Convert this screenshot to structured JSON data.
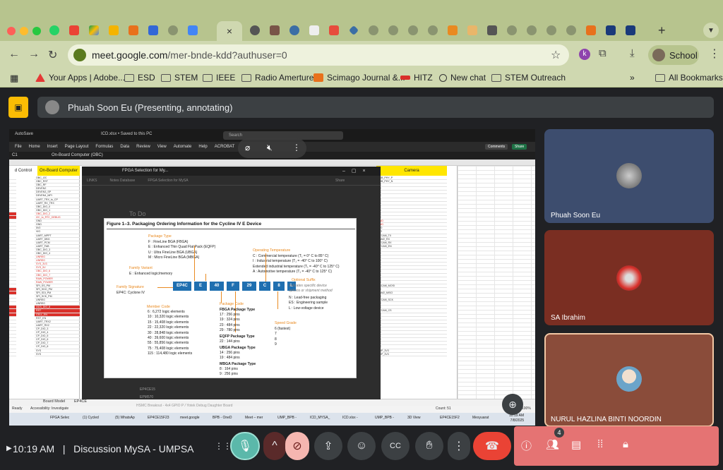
{
  "browser": {
    "url_host": "meet.google.com",
    "url_path": "/mer-bnde-kdd?authuser=0",
    "profile_label": "School",
    "extension_letter": "k",
    "new_tab_symbol": "+",
    "active_tab_close": "×",
    "accent": "#cfd8b0",
    "tabstrip_color": "#b7c48e"
  },
  "bookmarks": [
    {
      "label": "Your Apps | Adobe...",
      "icon": "adobe-icon"
    },
    {
      "label": "ESD",
      "icon": "folder-icon"
    },
    {
      "label": "STEM",
      "icon": "folder-icon"
    },
    {
      "label": "IEEE",
      "icon": "folder-icon"
    },
    {
      "label": "Radio Amerture",
      "icon": "folder-icon"
    },
    {
      "label": "Scimago Journal &...",
      "icon": "sjr-icon"
    },
    {
      "label": "HITZ",
      "icon": "hitz-icon"
    },
    {
      "label": "New chat",
      "icon": "chat-icon"
    },
    {
      "label": "STEM Outreach",
      "icon": "folder-icon"
    },
    {
      "label": "All Bookmarks",
      "icon": "folder-icon"
    }
  ],
  "meet": {
    "presenter_banner": "Phuah Soon Eu (Presenting, annotating)",
    "time": "10:19 AM",
    "separator": "|",
    "meeting_title": "Discussion MySA - UMPSA",
    "participant_badge": "4",
    "leave_color": "#ea4335",
    "panel_color": "#e57373"
  },
  "participants": [
    {
      "name": "Phuah Soon Eu",
      "bg": "#3d4d6e"
    },
    {
      "name": "SA Ibrahim",
      "bg": "#7a2e22"
    },
    {
      "name": "NURUL HAZLINA BINTI NOORDIN",
      "bg": "#8a4c3a"
    }
  ],
  "excel": {
    "autosave": "AutoSave",
    "file_title": "ICD.xlsx • Saved to this PC",
    "search": "Search",
    "ribbon_tabs": [
      "File",
      "Home",
      "Insert",
      "Page Layout",
      "Formulas",
      "Data",
      "Review",
      "View",
      "Automate",
      "Help",
      "ACROBAT"
    ],
    "comments": "Comments",
    "share": "Share",
    "name_box": "C1",
    "formula": "On-Board Computer (OBC)",
    "col_left_header": "d Control",
    "col_obc_header": "On-Board Computer",
    "col_camera_header": "Camera",
    "obc_rows": [
      "OBC_I2C",
      "OBC_RST",
      "OBC_RF",
      "DEVEN2",
      "DEVEN3_SP",
      "DEVEN4_MPI",
      "UART_TRX_to_CP",
      "UART_RX_TRX",
      "OBC_DIO_0",
      "OBC_DIO_1",
      "OBC_DIO_2",
      "I2C_to_RTC_DEBUG",
      "GND",
      "GND",
      "5V0",
      "VIO",
      "UART_MPPT",
      "UART_DBG",
      "UART_PCM",
      "UART_FAB",
      "OBC_DIO_3",
      "OBC_DIO_4",
      "UNREG",
      "UNREG",
      "SYS_3V3",
      "SYS_5V",
      "OBC_DIO_6",
      "OBC_DIO_7",
      "RAW_POWER",
      "RAW_POWER",
      "SPI_SS_PM",
      "SPI_SDO_PM",
      "SPI_SDI_PM",
      "SPI_SCK_PM",
      "UNREG",
      "UNREG",
      "OCS_DIO_8",
      "RST",
      "CELL_EN",
      "RST_EN",
      "UART_TRX2",
      "UART_RX2",
      "CP_DIO_3",
      "CP_DIO_4",
      "CP_DIO_5",
      "CP_DIO_6",
      "CP_DIO_7",
      "CP_DIO_8",
      "SYS",
      "SYS"
    ],
    "camera_rows": [
      "USB_PHY_P",
      "USB_PHY_N",
      "NC",
      "NC",
      "NC",
      "NC",
      "NC",
      "NC",
      "NC",
      "NC",
      "NC",
      "NC",
      "GND",
      "GND",
      "5V0",
      "VIO",
      "STCAM_TX",
      "CAM2_RX",
      "STCAM_RX",
      "STCAM_EN",
      "NC",
      "NC",
      "NC",
      "NC",
      "NC",
      "NC",
      "NC",
      "NC",
      "NC",
      "NC",
      "SSCAM_MOSI",
      "NC",
      "CAM2_MISO",
      "NC",
      "STCAM_SCK",
      "NC",
      "NC",
      "STCAM_CS",
      "NC",
      "NC",
      "NC",
      "NC",
      "NC",
      "NC",
      "NC",
      "NC",
      "NC",
      "NC",
      "SUP_3V3",
      "SUP_3V3"
    ],
    "sheet_tabs": [
      "Board Model",
      "EP4CE"
    ],
    "status_ready": "Ready",
    "status_access": "Accessibility: Investigate",
    "status_count": "Count: 51",
    "status_zoom": "100%",
    "taskbar": [
      "FPGA Selec",
      "(1) Cycled",
      "(5) WhatsAp",
      "EP4CE15F23",
      "meet.google",
      "BPB - OneD",
      "Meet – mer",
      "UMP_BPB - ",
      "ICD_MYSA_",
      "ICD.xlsx - ",
      "UMP_BPB - ",
      "3D View",
      "EP4CE15F2",
      "Mesyuarat"
    ],
    "clock_time": "10:19 AM",
    "clock_date": "7/8/2025"
  },
  "pdf_window": {
    "tab_title": "FPGA Selection for My...",
    "addr_items": [
      "LINKS",
      "Notes Database",
      "FPGA Selection for MySA"
    ],
    "share_label": "Share",
    "todo": "To Do",
    "bottom_lines": [
      "EP4CE15",
      "EPM570",
      "HSMC Breakout - 4x4 GPIO P / Yotek Debug Daughter Board"
    ]
  },
  "figure": {
    "title": "Figure 1–3. Packaging Ordering Information for the Cycline IV E Device",
    "package_type_label": "Package Type",
    "package_types": [
      "F   :   FineLine BGA (FBGA)",
      "E   :   Enhanced Thin Quad Flat Pack (EQFP)",
      "U   :   Ultra FineLine BGA (UBGA)",
      "M   :   Micro FineLine BGA (MBGA)"
    ],
    "operating_temp_label": "Operating Temperature",
    "operating_temps": [
      "C   :   Commercial temperature (T₁ = 0° C to 85° C)",
      "I    :   Industrial temperature (T₁ = -40° C to 100° C)",
      "     Extended industrial temperature (T₁ = -40° C to 125° C)",
      "A   :   Automotive temperature (T₁ = -40° C to 125° C)"
    ],
    "family_variant_label": "Family Variant",
    "family_variant": "E   :   Enhanced logic/memory",
    "family_signature_label": "Family Signature",
    "family_signature": "EP4C:   Cyclone IV",
    "code_parts": [
      "EP4C",
      "E",
      "40",
      "F",
      "29",
      "C",
      "8",
      "L"
    ],
    "optional_suffix_label": "Optional Suffix",
    "optional_suffix_desc": [
      "Indicates specific device",
      "options or shipment method"
    ],
    "optional_suffixes": [
      "N    :   Lead-free packaging",
      "ES  :   Engineering sample",
      "L    :   Low-voltage device"
    ],
    "member_code_label": "Member Code",
    "member_codes": [
      "6     :   6,272 logic elements",
      "10   :   10,320 logic elements",
      "15   :   15,408 logic elements",
      "22   :   22,320 logic elements",
      "30   :   28,848 logic elements",
      "40   :   39,600 logic elements",
      "55   :   55,856 logic elements",
      "75   :   75,408 logic elements",
      "115 :   114,480 logic elements"
    ],
    "package_code_label": "Package Code",
    "fbga_title": "FBGA Package Type",
    "fbga": [
      "17   :   256 pins",
      "19   :   324 pins",
      "23   :   484 pins",
      "29   :   780 pins"
    ],
    "eqfp_title": "EQFP Package Type",
    "eqfp": [
      "22   :   144 pins"
    ],
    "ubga_title": "UBGA Package Type",
    "ubga": [
      "14   :   256 pins",
      "19   :   484 pins"
    ],
    "mbga_title": "MBGA Package Type",
    "mbga": [
      "8     :   164 pins",
      "9     :   256 pins"
    ],
    "speed_grade_label": "Speed Grade",
    "speed_grades": [
      "6 (fastest)",
      "7",
      "8",
      "9"
    ]
  },
  "icons": {
    "present": "presentation-icon",
    "mic": "microphone-icon",
    "cam_off": "camera-off-icon",
    "share_screen": "present-screen-icon",
    "emoji": "emoji-icon",
    "captions": "captions-icon",
    "hand": "raise-hand-icon",
    "more": "more-vert-icon",
    "leave": "call-end-icon",
    "info": "info-icon",
    "people": "people-icon",
    "chat": "chat-icon",
    "activities": "activities-icon",
    "lock": "host-controls-icon"
  }
}
